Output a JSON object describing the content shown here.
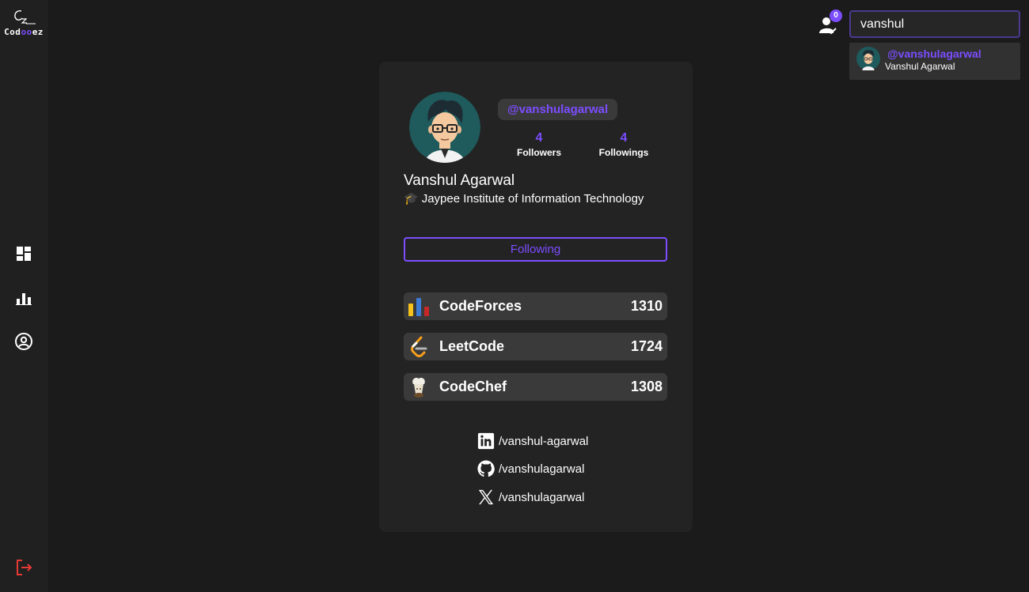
{
  "brand": {
    "logo_text_part1": "Cod",
    "logo_text_accent": "oo",
    "logo_text_part2": "ez",
    "accent_color": "#7c4dff"
  },
  "sidebar": {
    "items": [
      {
        "icon": "dashboard-icon"
      },
      {
        "icon": "bar-chart-icon"
      },
      {
        "icon": "user-circle-icon"
      }
    ],
    "logout_icon": "logout-icon"
  },
  "header": {
    "notification_count": "0",
    "search": {
      "value": "vanshul",
      "placeholder": ""
    },
    "search_results": [
      {
        "handle": "@vanshulagarwal",
        "name": "Vanshul Agarwal"
      }
    ]
  },
  "profile": {
    "handle": "@vanshulagarwal",
    "followers_count": "4",
    "followers_label": "Followers",
    "followings_count": "4",
    "followings_label": "Followings",
    "full_name": "Vanshul Agarwal",
    "institute_icon": "🎓",
    "institute": "Jaypee Institute of Information Technology",
    "follow_button_label": "Following",
    "platforms": [
      {
        "name": "CodeForces",
        "rating": "1310",
        "icon": "codeforces-icon"
      },
      {
        "name": "LeetCode",
        "rating": "1724",
        "icon": "leetcode-icon"
      },
      {
        "name": "CodeChef",
        "rating": "1308",
        "icon": "codechef-icon"
      }
    ],
    "socials": [
      {
        "icon": "linkedin-icon",
        "text": "/vanshul-agarwal"
      },
      {
        "icon": "github-icon",
        "text": "/vanshulagarwal"
      },
      {
        "icon": "x-twitter-icon",
        "text": "/vanshulagarwal"
      }
    ]
  }
}
